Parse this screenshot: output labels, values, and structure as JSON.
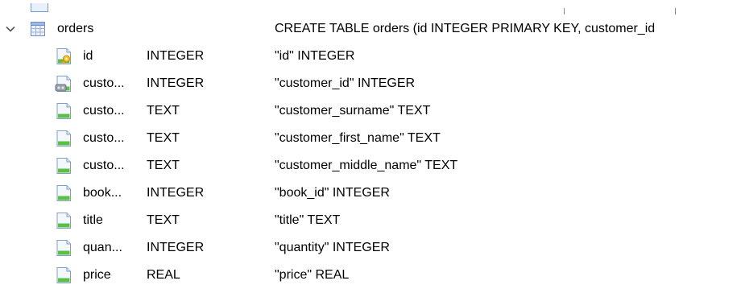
{
  "table": {
    "name": "orders",
    "schema": "CREATE TABLE orders (id INTEGER PRIMARY KEY, customer_id",
    "expanded": true,
    "icon": "table-icon"
  },
  "fields": [
    {
      "name": "id",
      "type": "INTEGER",
      "schema": "\"id\" INTEGER",
      "icon": "primary-key-field-icon"
    },
    {
      "name": "custo...",
      "type": "INTEGER",
      "schema": "\"customer_id\" INTEGER",
      "icon": "foreign-key-field-icon"
    },
    {
      "name": "custo...",
      "type": "TEXT",
      "schema": "\"customer_surname\" TEXT",
      "icon": "field-icon"
    },
    {
      "name": "custo...",
      "type": "TEXT",
      "schema": "\"customer_first_name\" TEXT",
      "icon": "field-icon"
    },
    {
      "name": "custo...",
      "type": "TEXT",
      "schema": "\"customer_middle_name\" TEXT",
      "icon": "field-icon"
    },
    {
      "name": "book...",
      "type": "INTEGER",
      "schema": "\"book_id\" INTEGER",
      "icon": "field-icon"
    },
    {
      "name": "title",
      "type": "TEXT",
      "schema": "\"title\" TEXT",
      "icon": "field-icon"
    },
    {
      "name": "quan...",
      "type": "INTEGER",
      "schema": "\"quantity\" INTEGER",
      "icon": "field-icon"
    },
    {
      "name": "price",
      "type": "REAL",
      "schema": "\"price\" REAL",
      "icon": "field-icon"
    }
  ]
}
